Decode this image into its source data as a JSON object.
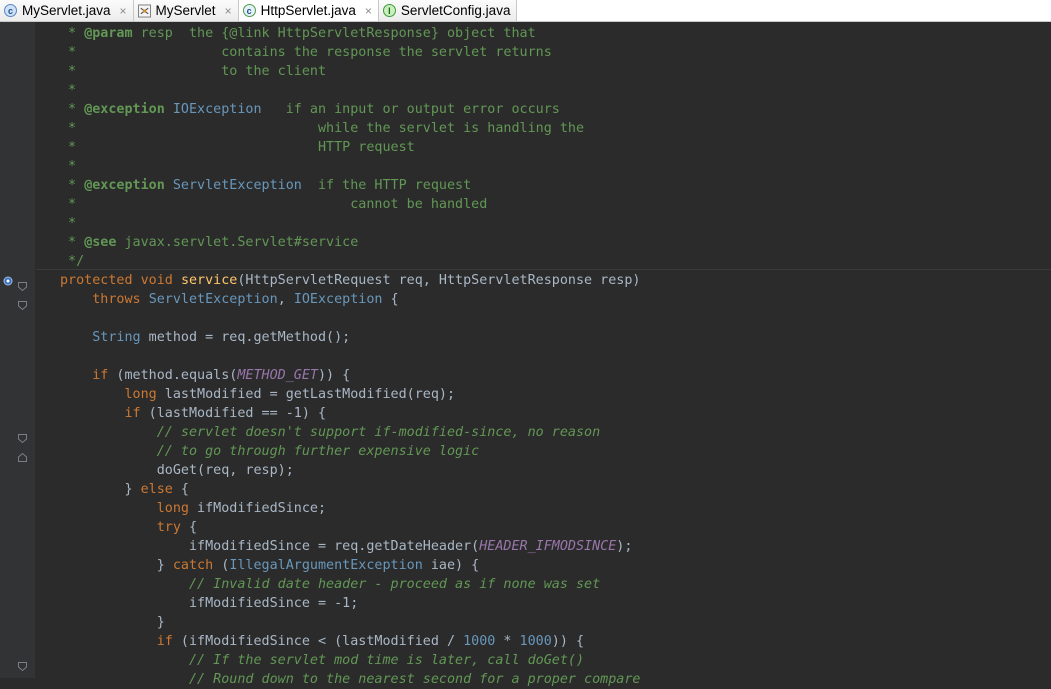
{
  "tabs": [
    {
      "label": "MyServlet.java",
      "icon": "class-icon",
      "closable": true,
      "active": false
    },
    {
      "label": "MyServlet",
      "icon": "servlet-icon",
      "closable": true,
      "active": false
    },
    {
      "label": "HttpServlet.java",
      "icon": "abstract-class-icon",
      "closable": true,
      "active": true
    },
    {
      "label": "ServletConfig.java",
      "icon": "interface-icon",
      "closable": false,
      "active": false
    }
  ],
  "tab_close_glyph": "×",
  "colors": {
    "editor_bg": "#2b2b2b",
    "gutter_bg": "#313335",
    "keyword": "#cc7832",
    "javadoc": "#629755",
    "comment": "#629755",
    "constant": "#9876aa",
    "number": "#6897bb",
    "method_decl": "#ffc66d",
    "text": "#a9b7c6"
  },
  "gutter_icons": [
    "override-icon",
    "fold-icon"
  ],
  "code_lines": [
    [
      [
        "doc",
        " * "
      ],
      [
        "doctag",
        "@param"
      ],
      [
        "doc",
        " resp  the {@link HttpServletResponse} object that"
      ]
    ],
    [
      [
        "doc",
        " *                  contains the response the servlet returns"
      ]
    ],
    [
      [
        "doc",
        " *                  to the client"
      ]
    ],
    [
      [
        "doc",
        " *"
      ]
    ],
    [
      [
        "doc",
        " * "
      ],
      [
        "doctag",
        "@exception"
      ],
      [
        "doc",
        " "
      ],
      [
        "ty",
        "IOException"
      ],
      [
        "doc",
        "   if an input or output error occurs"
      ]
    ],
    [
      [
        "doc",
        " *                              while the servlet is handling the"
      ]
    ],
    [
      [
        "doc",
        " *                              HTTP request"
      ]
    ],
    [
      [
        "doc",
        " *"
      ]
    ],
    [
      [
        "doc",
        " * "
      ],
      [
        "doctag",
        "@exception"
      ],
      [
        "doc",
        " "
      ],
      [
        "ty",
        "ServletException"
      ],
      [
        "doc",
        "  if the HTTP request"
      ]
    ],
    [
      [
        "doc",
        " *                                  cannot be handled"
      ]
    ],
    [
      [
        "doc",
        " *"
      ]
    ],
    [
      [
        "doc",
        " * "
      ],
      [
        "doctag",
        "@see"
      ],
      [
        "doc",
        " javax.servlet.Servlet#service"
      ]
    ],
    [
      [
        "doc",
        " */"
      ]
    ],
    [
      [
        "kw",
        "protected void "
      ],
      [
        "fn",
        "service"
      ],
      [
        "tx",
        "(HttpServletRequest req, HttpServletResponse resp)"
      ]
    ],
    [
      [
        "tx",
        "    "
      ],
      [
        "kw",
        "throws "
      ],
      [
        "ty",
        "ServletException"
      ],
      [
        "tx",
        ", "
      ],
      [
        "ty",
        "IOException"
      ],
      [
        "tx",
        " {"
      ]
    ],
    [
      [
        "tx",
        ""
      ]
    ],
    [
      [
        "tx",
        "    "
      ],
      [
        "ty",
        "String"
      ],
      [
        "tx",
        " method = req.getMethod();"
      ]
    ],
    [
      [
        "tx",
        ""
      ]
    ],
    [
      [
        "tx",
        "    "
      ],
      [
        "kw",
        "if"
      ],
      [
        "tx",
        " (method.equals("
      ],
      [
        "cn",
        "METHOD_GET"
      ],
      [
        "tx",
        ")) {"
      ]
    ],
    [
      [
        "tx",
        "        "
      ],
      [
        "kw",
        "long"
      ],
      [
        "tx",
        " lastModified = getLastModified(req);"
      ]
    ],
    [
      [
        "tx",
        "        "
      ],
      [
        "kw",
        "if"
      ],
      [
        "tx",
        " (lastModified == -1) {"
      ]
    ],
    [
      [
        "tx",
        "            "
      ],
      [
        "cm",
        "// servlet doesn't support if-modified-since, no reason"
      ]
    ],
    [
      [
        "tx",
        "            "
      ],
      [
        "cm",
        "// to go through further expensive logic"
      ]
    ],
    [
      [
        "tx",
        "            doGet(req, resp);"
      ]
    ],
    [
      [
        "tx",
        "        } "
      ],
      [
        "kw",
        "else"
      ],
      [
        "tx",
        " {"
      ]
    ],
    [
      [
        "tx",
        "            "
      ],
      [
        "kw",
        "long"
      ],
      [
        "tx",
        " ifModifiedSince;"
      ]
    ],
    [
      [
        "tx",
        "            "
      ],
      [
        "kw",
        "try"
      ],
      [
        "tx",
        " {"
      ]
    ],
    [
      [
        "tx",
        "                ifModifiedSince = req.getDateHeader("
      ],
      [
        "cn",
        "HEADER_IFMODSINCE"
      ],
      [
        "tx",
        ");"
      ]
    ],
    [
      [
        "tx",
        "            } "
      ],
      [
        "kw",
        "catch"
      ],
      [
        "tx",
        " ("
      ],
      [
        "ty",
        "IllegalArgumentException"
      ],
      [
        "tx",
        " iae) {"
      ]
    ],
    [
      [
        "tx",
        "                "
      ],
      [
        "cm",
        "// Invalid date header - proceed as if none was set"
      ]
    ],
    [
      [
        "tx",
        "                ifModifiedSince = -1;"
      ]
    ],
    [
      [
        "tx",
        "            }"
      ]
    ],
    [
      [
        "tx",
        "            "
      ],
      [
        "kw",
        "if"
      ],
      [
        "tx",
        " (ifModifiedSince < (lastModified / "
      ],
      [
        "num",
        "1000"
      ],
      [
        "tx",
        " * "
      ],
      [
        "num",
        "1000"
      ],
      [
        "tx",
        ")) {"
      ]
    ],
    [
      [
        "tx",
        "                "
      ],
      [
        "cm",
        "// If the servlet mod time is later, call doGet()"
      ]
    ],
    [
      [
        "tx",
        "                "
      ],
      [
        "cm",
        "// Round down to the nearest second for a proper compare"
      ]
    ]
  ]
}
